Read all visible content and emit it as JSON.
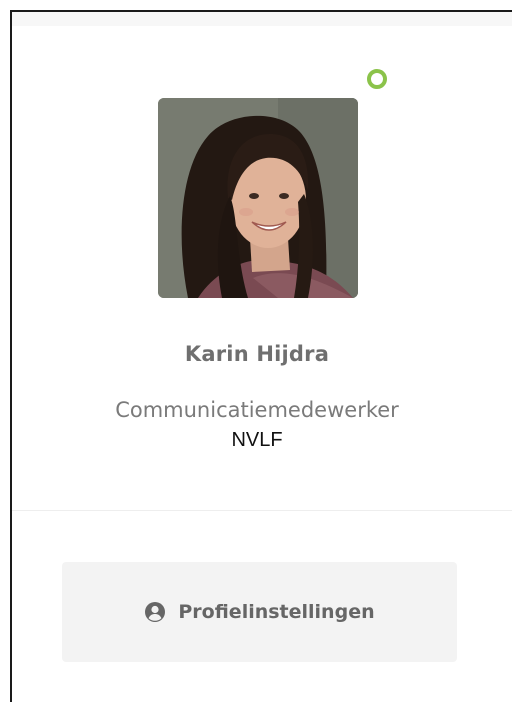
{
  "profile": {
    "name": "Karin Hijdra",
    "role": "Communicatiemedewerker",
    "organization": "NVLF",
    "status": "online",
    "status_color": "#8bc34a",
    "avatar_icon": "profile-photo"
  },
  "actions": {
    "profile_settings_label": "Profielinstellingen",
    "profile_settings_icon": "user-circle-icon"
  }
}
